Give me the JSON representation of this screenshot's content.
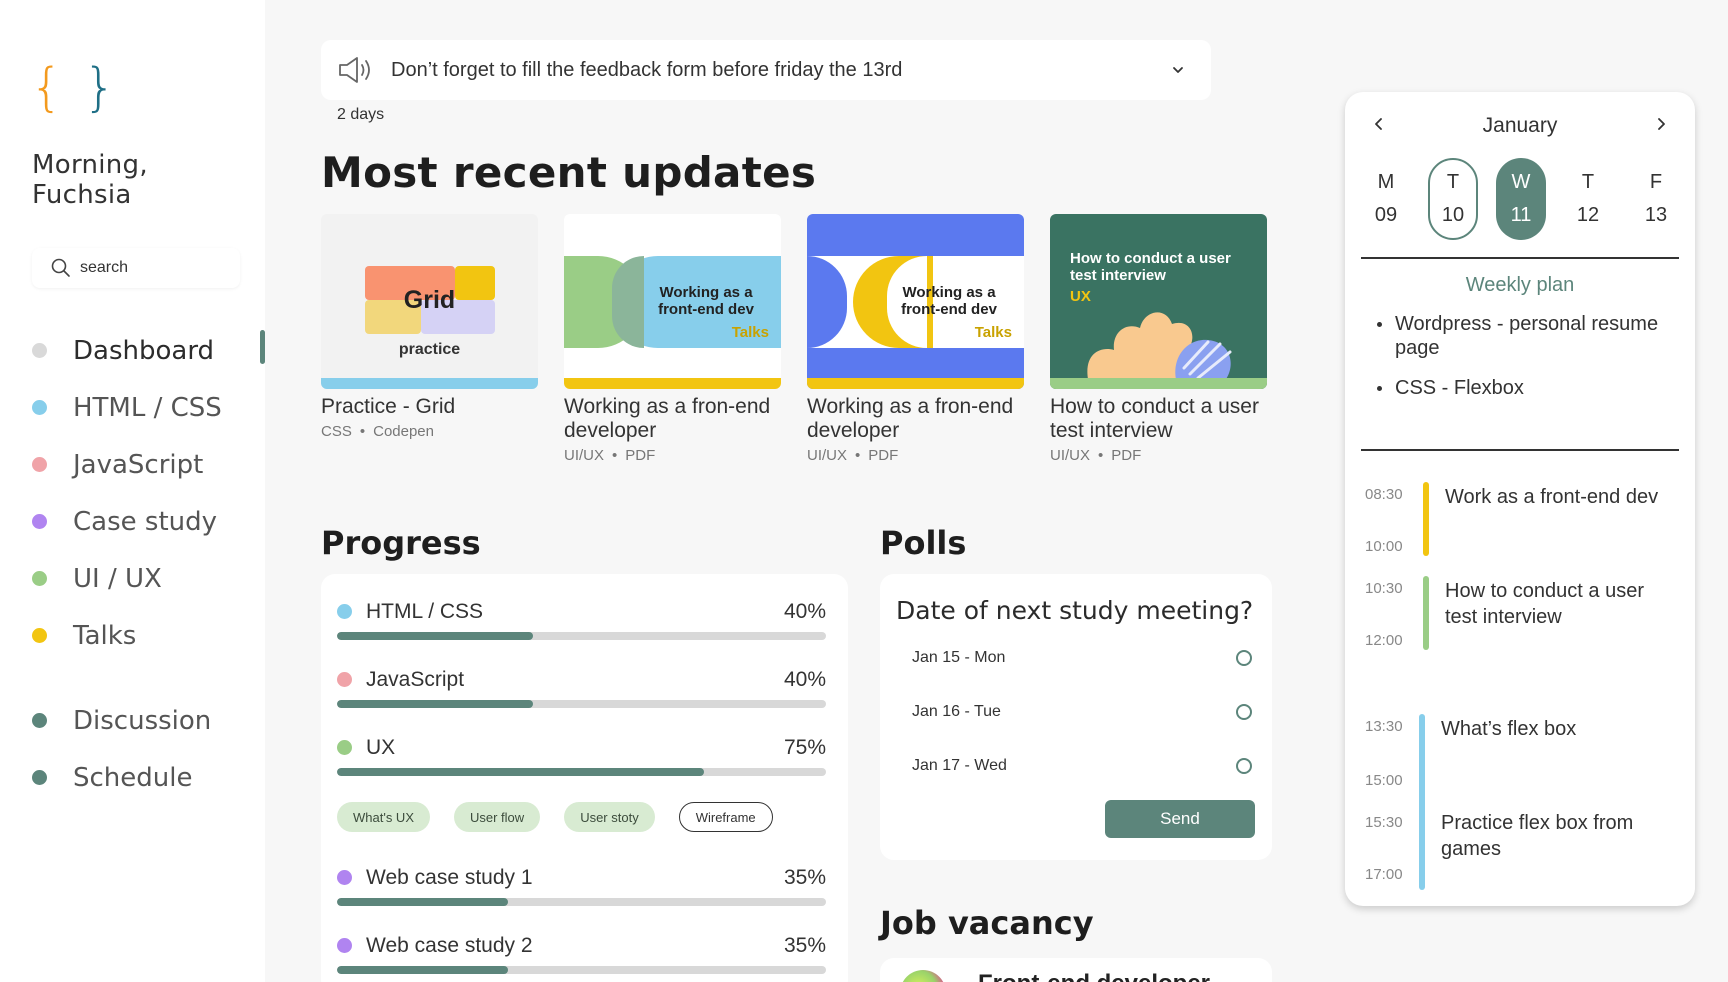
{
  "sidebar": {
    "logo_left": "{",
    "logo_right": "}",
    "greeting_line1": "Morning,",
    "greeting_line2": "Fuchsia",
    "search_placeholder": "search",
    "nav": [
      {
        "label": "Dashboard",
        "color": "#d9d9d9",
        "active": true
      },
      {
        "label": "HTML / CSS",
        "color": "#87ceeb"
      },
      {
        "label": "JavaScript",
        "color": "#f0a3a8"
      },
      {
        "label": "Case study",
        "color": "#b084f0"
      },
      {
        "label": "UI / UX",
        "color": "#9acd86"
      },
      {
        "label": "Talks",
        "color": "#f2c511"
      }
    ],
    "nav2": [
      {
        "label": "Discussion",
        "color": "#5c857b"
      },
      {
        "label": "Schedule",
        "color": "#5c857b"
      }
    ]
  },
  "announcement": {
    "message": "Don’t forget to fill the feedback form before friday the 13rd",
    "due": "2 days",
    "icon": "speaker-icon"
  },
  "updates": {
    "title": "Most recent updates",
    "cards": [
      {
        "thumb_title": "Grid",
        "thumb_sub": "practice",
        "title": "Practice - Grid",
        "cat": "CSS",
        "type": "Codepen"
      },
      {
        "thumb_title": "Working as a front-end dev",
        "thumb_sub": "Talks",
        "title": "Working as a fron-end developer",
        "cat": "UI/UX",
        "type": "PDF"
      },
      {
        "thumb_title": "Working as a front-end dev",
        "thumb_sub": "Talks",
        "title": "Working as a fron-end developer",
        "cat": "UI/UX",
        "type": "PDF"
      },
      {
        "thumb_title": "How to conduct a user test interview",
        "thumb_sub": "UX",
        "title": "How to conduct a user test interview",
        "cat": "UI/UX",
        "type": "PDF"
      }
    ]
  },
  "progress": {
    "title": "Progress",
    "items": [
      {
        "label": "HTML / CSS",
        "pct_label": "40%",
        "value": 0.4,
        "color": "#87ceeb"
      },
      {
        "label": "JavaScript",
        "pct_label": "40%",
        "value": 0.4,
        "color": "#f0a3a8"
      },
      {
        "label": "UX",
        "pct_label": "75%",
        "value": 0.75,
        "color": "#9acd86"
      },
      {
        "label": "Web case study 1",
        "pct_label": "35%",
        "value": 0.35,
        "color": "#b084f0"
      },
      {
        "label": "Web case study 2",
        "pct_label": "35%",
        "value": 0.35,
        "color": "#b084f0"
      }
    ],
    "tags": [
      "What's UX",
      "User flow",
      "User stoty",
      "Wireframe"
    ]
  },
  "polls": {
    "title": "Polls",
    "question": "Date of next study meeting?",
    "options": [
      "Jan 15 - Mon",
      "Jan 16 - Tue",
      "Jan 17 - Wed"
    ],
    "send_label": "Send"
  },
  "jobs": {
    "title": "Job vacancy",
    "first_title": "Front-end developer"
  },
  "calendar": {
    "month": "January",
    "days": [
      {
        "dow": "M",
        "num": "09",
        "state": "none"
      },
      {
        "dow": "T",
        "num": "10",
        "state": "outline"
      },
      {
        "dow": "W",
        "num": "11",
        "state": "filled"
      },
      {
        "dow": "T",
        "num": "12",
        "state": "none"
      },
      {
        "dow": "F",
        "num": "13",
        "state": "none"
      }
    ],
    "weekly_title": "Weekly plan",
    "weekly": [
      "Wordpress - personal resume page",
      "CSS - Flexbox"
    ],
    "schedule": [
      {
        "start": "08:30",
        "end": "10:00",
        "text": "Work as a front-end dev",
        "color": "#f2c511"
      },
      {
        "start": "10:30",
        "end": "12:00",
        "text": "How to conduct a user test interview",
        "color": "#9acd86"
      },
      {
        "start": "13:30",
        "end": "15:00",
        "text": "What’s flex box",
        "color": "#87ceeb"
      },
      {
        "start": "15:30",
        "end": "17:00",
        "text": "Practice flex box from games",
        "color": "#87ceeb"
      }
    ]
  }
}
